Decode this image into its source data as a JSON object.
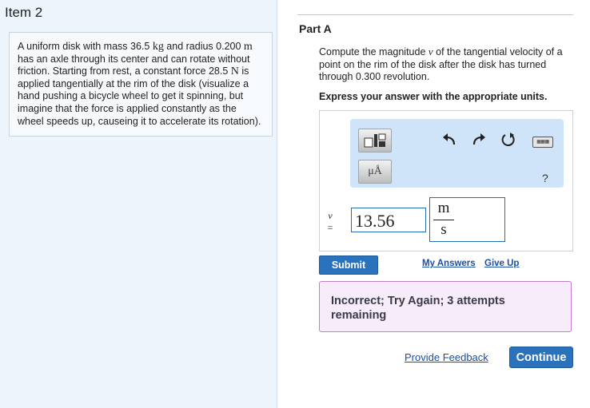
{
  "item": {
    "title": "Item 2"
  },
  "problem": {
    "text_1": "A uniform disk with mass 36.5 ",
    "unit_kg": "kg",
    "text_2": " and radius 0.200 ",
    "unit_m": "m",
    "text_3": " has an axle through its center and can rotate without friction. Starting from rest, a constant force 28.5 ",
    "unit_N": "N",
    "text_4": " is applied tangentially at the rim of the disk (visualize a hand pushing a bicycle wheel to get it spinning, but imagine that the force is applied constantly as the wheel speeds up, causeing it to accelerate its rotation)."
  },
  "part": {
    "title": "Part A",
    "question_1": "Compute the magnitude ",
    "question_var": "v",
    "question_2": " of the tangential velocity of a point on the rim of the disk after the disk has turned through 0.300 revolution.",
    "instruction": "Express your answer with the appropriate units."
  },
  "toolbar": {
    "units_label": "μÅ",
    "undo_icon": "undo-arrow",
    "redo_icon": "redo-arrow",
    "reset_icon": "reset-circle-arrow",
    "keyboard_icon": "keyboard",
    "help_label": "?"
  },
  "answer": {
    "variable": "v",
    "equals": "=",
    "value": "13.56",
    "unit_numerator": "m",
    "unit_denominator": "s"
  },
  "actions": {
    "submit": "Submit",
    "my_answers": "My Answers",
    "give_up": "Give Up"
  },
  "feedback": {
    "message": "Incorrect; Try Again; 3 attempts remaining"
  },
  "footer": {
    "provide_feedback": "Provide Feedback",
    "continue": "Continue"
  },
  "colors": {
    "accent": "#2b72bd",
    "left_pane": "#eef4fb",
    "toolbar": "#cfe4f8",
    "feedback_bg": "#f7ecf9",
    "feedback_border": "#c47ad1",
    "link": "#1d4fa3"
  }
}
